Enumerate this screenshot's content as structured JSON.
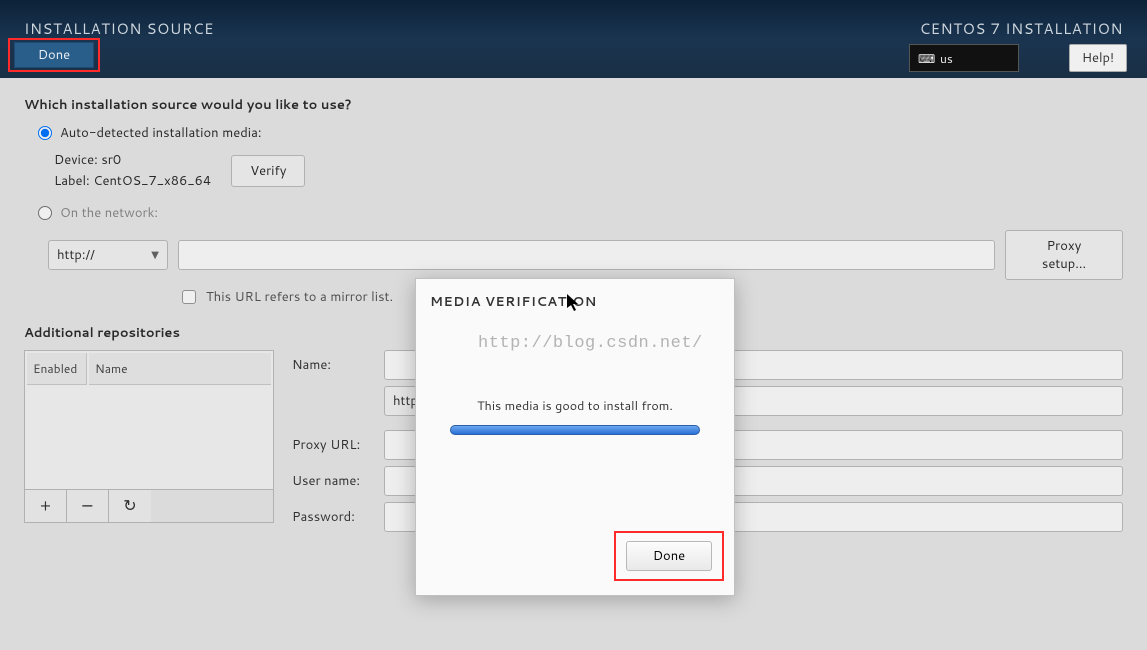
{
  "header": {
    "title_left": "INSTALLATION SOURCE",
    "title_right": "CENTOS 7 INSTALLATION",
    "done_label": "Done",
    "keyboard_layout": "us",
    "help_label": "Help!"
  },
  "source": {
    "question": "Which installation source would you like to use?",
    "auto_label": "Auto-detected installation media:",
    "device_label": "Device:",
    "device_value": "sr0",
    "label_label": "Label:",
    "label_value": "CentOS_7_x86_64",
    "verify_label": "Verify",
    "network_label": "On the network:",
    "protocol_selected": "http://",
    "url_value": "",
    "proxy_setup_label": "Proxy setup...",
    "mirror_checkbox_label": "This URL refers to a mirror list."
  },
  "repos": {
    "section_title": "Additional repositories",
    "col_enabled": "Enabled",
    "col_name": "Name",
    "add_icon": "+",
    "remove_icon": "−",
    "refresh_icon": "↻",
    "form": {
      "name_label": "Name:",
      "protocol_selected": "http://",
      "proxy_url_label": "Proxy URL:",
      "username_label": "User name:",
      "password_label": "Password:"
    }
  },
  "modal": {
    "title": "MEDIA VERIFICATION",
    "message": "This media is good to install from.",
    "done_label": "Done"
  },
  "watermark": "http://blog.csdn.net/"
}
